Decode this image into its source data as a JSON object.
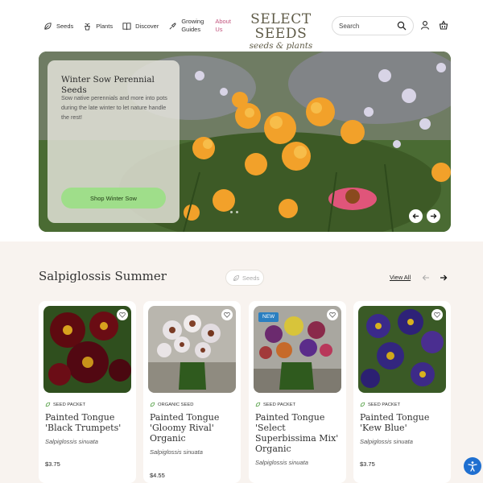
{
  "header": {
    "nav": [
      {
        "label": "Seeds",
        "icon": "leaf-icon"
      },
      {
        "label": "Plants",
        "icon": "plant-pot-icon"
      },
      {
        "label": "Discover",
        "icon": "book-icon"
      },
      {
        "label": "Growing Guides",
        "icon": "trowel-icon"
      },
      {
        "label": "About Us",
        "icon": ""
      }
    ],
    "logo": {
      "line1": "SELECT SEEDS",
      "line2": "seeds & plants"
    },
    "search": {
      "placeholder": "Search",
      "value": ""
    },
    "icons": [
      "search-icon",
      "account-icon",
      "cart-icon"
    ]
  },
  "hero": {
    "title": "Winter Sow Perennial Seeds",
    "subtitle": "Sow native perennials and more into pots during the late winter to let nature handle the rest!",
    "button": "Shop Winter Sow"
  },
  "section": {
    "title": "Salpiglossis Summer",
    "chip": "Seeds",
    "view_all": "View All",
    "products": [
      {
        "type": "SEED PACKET",
        "name": "Painted Tongue 'Black Trumpets'",
        "latin": "Salpiglossis sinuata",
        "price": "$3.75",
        "badge": ""
      },
      {
        "type": "ORGANIC SEED",
        "name": "Painted Tongue 'Gloomy Rival' Organic",
        "latin": "Salpiglossis sinuata",
        "price": "$4.55",
        "badge": ""
      },
      {
        "type": "SEED PACKET",
        "name": "Painted Tongue 'Select Superbissima Mix' Organic",
        "latin": "Salpiglossis sinuata",
        "price": "",
        "badge": "NEW"
      },
      {
        "type": "SEED PACKET",
        "name": "Painted Tongue 'Kew Blue'",
        "latin": "Salpiglossis sinuata",
        "price": "$3.75",
        "badge": ""
      }
    ]
  },
  "colors": {
    "accent_green": "#9fde8a",
    "about_pink": "#c2557e",
    "badge_blue": "#2a7fc1",
    "section_bg": "#f8f3ef"
  }
}
